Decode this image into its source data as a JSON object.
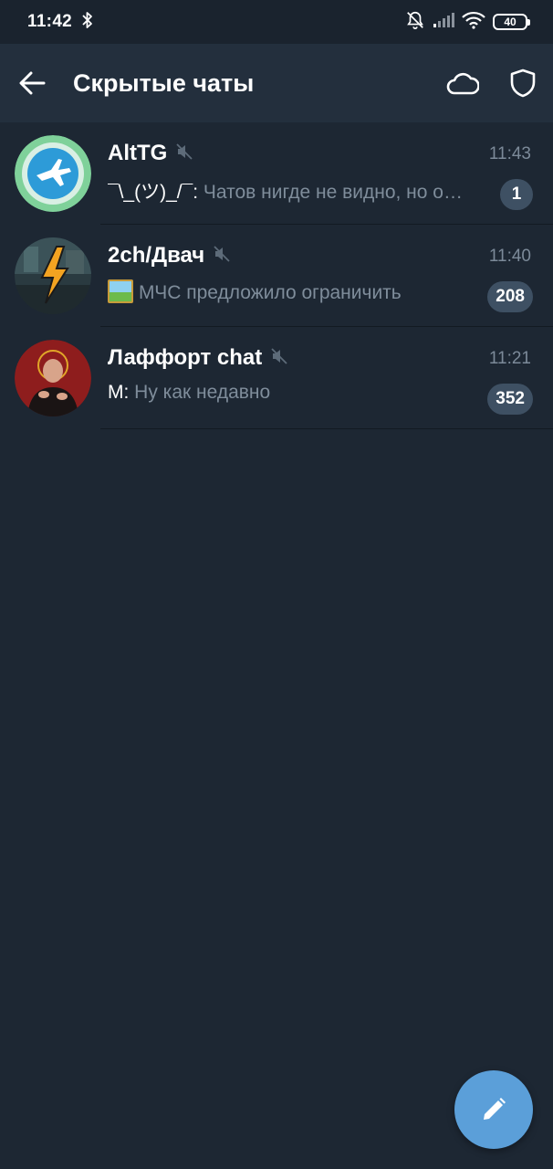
{
  "status_bar": {
    "time": "11:42",
    "battery": "40"
  },
  "toolbar": {
    "title": "Скрытые чаты"
  },
  "chats": [
    {
      "name": "AltTG",
      "time": "11:43",
      "sender": "¯\\_(ツ)_/¯: ",
      "preview": "Чатов нигде не видно, но они есть",
      "unread": "1",
      "muted": true
    },
    {
      "name": "2ch/Двач",
      "time": "11:40",
      "sender": "",
      "preview": "МЧС предложило ограничить",
      "unread": "208",
      "muted": true
    },
    {
      "name": "Лаффорт chat",
      "time": "11:21",
      "sender": "М: ",
      "preview": "Ну как недавно",
      "unread": "352",
      "muted": true
    }
  ],
  "colors": {
    "background": "#1d2733",
    "toolbar": "#232f3d",
    "badge": "#3e5063",
    "fab": "#5b9fd9"
  }
}
